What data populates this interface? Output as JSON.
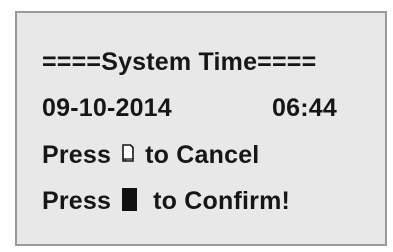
{
  "screen": {
    "title": "====System Time====",
    "date": "09-10-2014",
    "time": "06:44",
    "cancel": {
      "prefix": "Press",
      "suffix": "to Cancel",
      "icon": "page-outline-icon"
    },
    "confirm": {
      "prefix": "Press",
      "suffix": "to Confirm!",
      "icon": "solid-square-icon"
    }
  }
}
